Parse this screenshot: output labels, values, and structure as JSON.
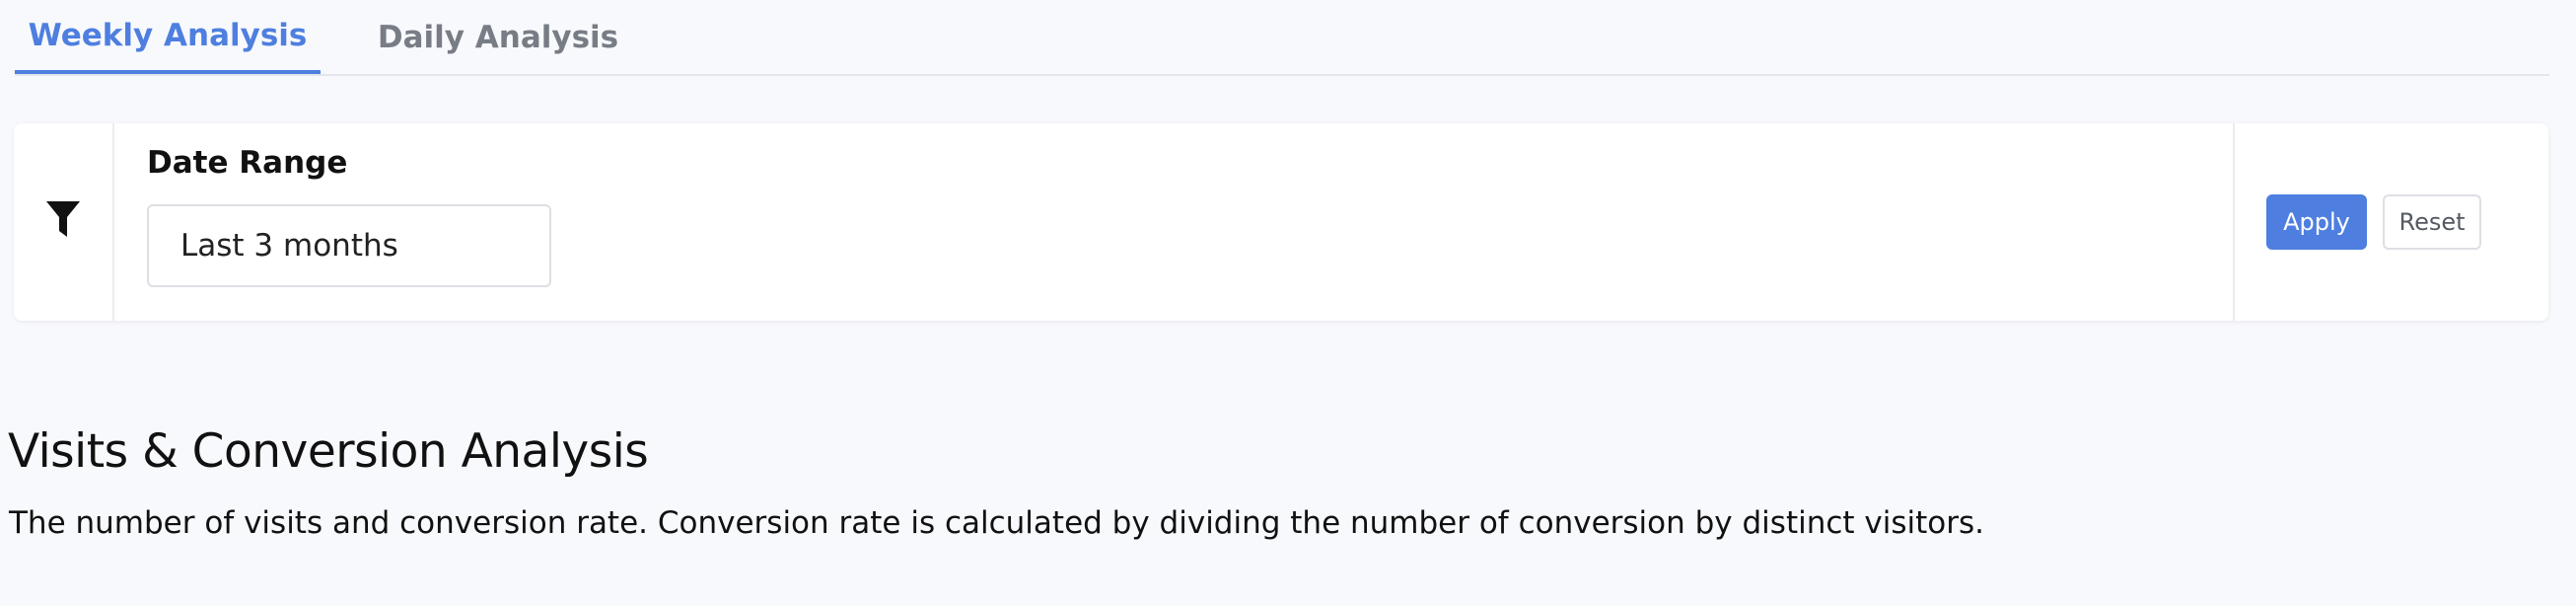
{
  "tabs": [
    {
      "label": "Weekly Analysis",
      "active": true
    },
    {
      "label": "Daily Analysis",
      "active": false
    }
  ],
  "filter": {
    "icon": "filter-icon",
    "label": "Date Range",
    "value": "Last 3 months",
    "apply_label": "Apply",
    "reset_label": "Reset"
  },
  "section": {
    "title": "Visits & Conversion Analysis",
    "description": "The number of visits and conversion rate. Conversion rate is calculated by dividing the number of conversion by distinct visitors."
  },
  "colors": {
    "accent": "#4e7fe0",
    "background": "#f8f9fc",
    "inactive_tab": "#777c85"
  }
}
